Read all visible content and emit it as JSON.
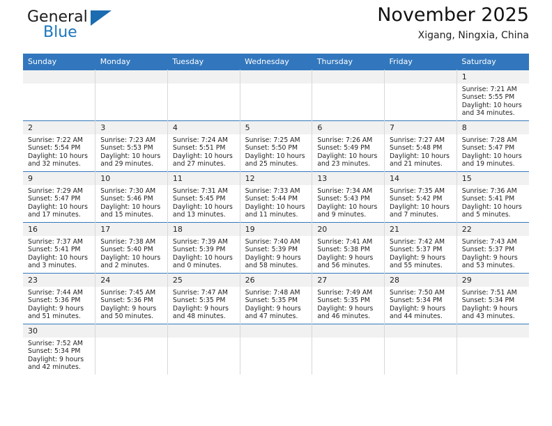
{
  "brand": {
    "name_top": "General",
    "name_bottom": "Blue",
    "triangle_icon": "brand-triangle-icon",
    "color_blue": "#1b76bc",
    "color_dark": "#1a1a1a"
  },
  "header": {
    "title": "November 2025",
    "subtitle": "Xigang, Ningxia, China"
  },
  "theme": {
    "header_bg": "#3277bd",
    "header_text": "#ffffff",
    "daynum_bg": "#f1f1f1",
    "cell_bg": "#ffffff",
    "grid_line": "#d7d7d7"
  },
  "weekday_headers": [
    "Sunday",
    "Monday",
    "Tuesday",
    "Wednesday",
    "Thursday",
    "Friday",
    "Saturday"
  ],
  "labels": {
    "sunrise_prefix": "Sunrise:",
    "sunset_prefix": "Sunset:",
    "daylight_prefix": "Daylight:"
  },
  "weeks": [
    [
      {
        "empty": true
      },
      {
        "empty": true
      },
      {
        "empty": true
      },
      {
        "empty": true
      },
      {
        "empty": true
      },
      {
        "empty": true
      },
      {
        "day": "1",
        "sunrise": "Sunrise: 7:21 AM",
        "sunset": "Sunset: 5:55 PM",
        "daylight": "Daylight: 10 hours and 34 minutes."
      }
    ],
    [
      {
        "day": "2",
        "sunrise": "Sunrise: 7:22 AM",
        "sunset": "Sunset: 5:54 PM",
        "daylight": "Daylight: 10 hours and 32 minutes."
      },
      {
        "day": "3",
        "sunrise": "Sunrise: 7:23 AM",
        "sunset": "Sunset: 5:53 PM",
        "daylight": "Daylight: 10 hours and 29 minutes."
      },
      {
        "day": "4",
        "sunrise": "Sunrise: 7:24 AM",
        "sunset": "Sunset: 5:51 PM",
        "daylight": "Daylight: 10 hours and 27 minutes."
      },
      {
        "day": "5",
        "sunrise": "Sunrise: 7:25 AM",
        "sunset": "Sunset: 5:50 PM",
        "daylight": "Daylight: 10 hours and 25 minutes."
      },
      {
        "day": "6",
        "sunrise": "Sunrise: 7:26 AM",
        "sunset": "Sunset: 5:49 PM",
        "daylight": "Daylight: 10 hours and 23 minutes."
      },
      {
        "day": "7",
        "sunrise": "Sunrise: 7:27 AM",
        "sunset": "Sunset: 5:48 PM",
        "daylight": "Daylight: 10 hours and 21 minutes."
      },
      {
        "day": "8",
        "sunrise": "Sunrise: 7:28 AM",
        "sunset": "Sunset: 5:47 PM",
        "daylight": "Daylight: 10 hours and 19 minutes."
      }
    ],
    [
      {
        "day": "9",
        "sunrise": "Sunrise: 7:29 AM",
        "sunset": "Sunset: 5:47 PM",
        "daylight": "Daylight: 10 hours and 17 minutes."
      },
      {
        "day": "10",
        "sunrise": "Sunrise: 7:30 AM",
        "sunset": "Sunset: 5:46 PM",
        "daylight": "Daylight: 10 hours and 15 minutes."
      },
      {
        "day": "11",
        "sunrise": "Sunrise: 7:31 AM",
        "sunset": "Sunset: 5:45 PM",
        "daylight": "Daylight: 10 hours and 13 minutes."
      },
      {
        "day": "12",
        "sunrise": "Sunrise: 7:33 AM",
        "sunset": "Sunset: 5:44 PM",
        "daylight": "Daylight: 10 hours and 11 minutes."
      },
      {
        "day": "13",
        "sunrise": "Sunrise: 7:34 AM",
        "sunset": "Sunset: 5:43 PM",
        "daylight": "Daylight: 10 hours and 9 minutes."
      },
      {
        "day": "14",
        "sunrise": "Sunrise: 7:35 AM",
        "sunset": "Sunset: 5:42 PM",
        "daylight": "Daylight: 10 hours and 7 minutes."
      },
      {
        "day": "15",
        "sunrise": "Sunrise: 7:36 AM",
        "sunset": "Sunset: 5:41 PM",
        "daylight": "Daylight: 10 hours and 5 minutes."
      }
    ],
    [
      {
        "day": "16",
        "sunrise": "Sunrise: 7:37 AM",
        "sunset": "Sunset: 5:41 PM",
        "daylight": "Daylight: 10 hours and 3 minutes."
      },
      {
        "day": "17",
        "sunrise": "Sunrise: 7:38 AM",
        "sunset": "Sunset: 5:40 PM",
        "daylight": "Daylight: 10 hours and 2 minutes."
      },
      {
        "day": "18",
        "sunrise": "Sunrise: 7:39 AM",
        "sunset": "Sunset: 5:39 PM",
        "daylight": "Daylight: 10 hours and 0 minutes."
      },
      {
        "day": "19",
        "sunrise": "Sunrise: 7:40 AM",
        "sunset": "Sunset: 5:39 PM",
        "daylight": "Daylight: 9 hours and 58 minutes."
      },
      {
        "day": "20",
        "sunrise": "Sunrise: 7:41 AM",
        "sunset": "Sunset: 5:38 PM",
        "daylight": "Daylight: 9 hours and 56 minutes."
      },
      {
        "day": "21",
        "sunrise": "Sunrise: 7:42 AM",
        "sunset": "Sunset: 5:37 PM",
        "daylight": "Daylight: 9 hours and 55 minutes."
      },
      {
        "day": "22",
        "sunrise": "Sunrise: 7:43 AM",
        "sunset": "Sunset: 5:37 PM",
        "daylight": "Daylight: 9 hours and 53 minutes."
      }
    ],
    [
      {
        "day": "23",
        "sunrise": "Sunrise: 7:44 AM",
        "sunset": "Sunset: 5:36 PM",
        "daylight": "Daylight: 9 hours and 51 minutes."
      },
      {
        "day": "24",
        "sunrise": "Sunrise: 7:45 AM",
        "sunset": "Sunset: 5:36 PM",
        "daylight": "Daylight: 9 hours and 50 minutes."
      },
      {
        "day": "25",
        "sunrise": "Sunrise: 7:47 AM",
        "sunset": "Sunset: 5:35 PM",
        "daylight": "Daylight: 9 hours and 48 minutes."
      },
      {
        "day": "26",
        "sunrise": "Sunrise: 7:48 AM",
        "sunset": "Sunset: 5:35 PM",
        "daylight": "Daylight: 9 hours and 47 minutes."
      },
      {
        "day": "27",
        "sunrise": "Sunrise: 7:49 AM",
        "sunset": "Sunset: 5:35 PM",
        "daylight": "Daylight: 9 hours and 46 minutes."
      },
      {
        "day": "28",
        "sunrise": "Sunrise: 7:50 AM",
        "sunset": "Sunset: 5:34 PM",
        "daylight": "Daylight: 9 hours and 44 minutes."
      },
      {
        "day": "29",
        "sunrise": "Sunrise: 7:51 AM",
        "sunset": "Sunset: 5:34 PM",
        "daylight": "Daylight: 9 hours and 43 minutes."
      }
    ],
    [
      {
        "day": "30",
        "sunrise": "Sunrise: 7:52 AM",
        "sunset": "Sunset: 5:34 PM",
        "daylight": "Daylight: 9 hours and 42 minutes."
      },
      {
        "empty": true
      },
      {
        "empty": true
      },
      {
        "empty": true
      },
      {
        "empty": true
      },
      {
        "empty": true
      },
      {
        "empty": true
      }
    ]
  ]
}
